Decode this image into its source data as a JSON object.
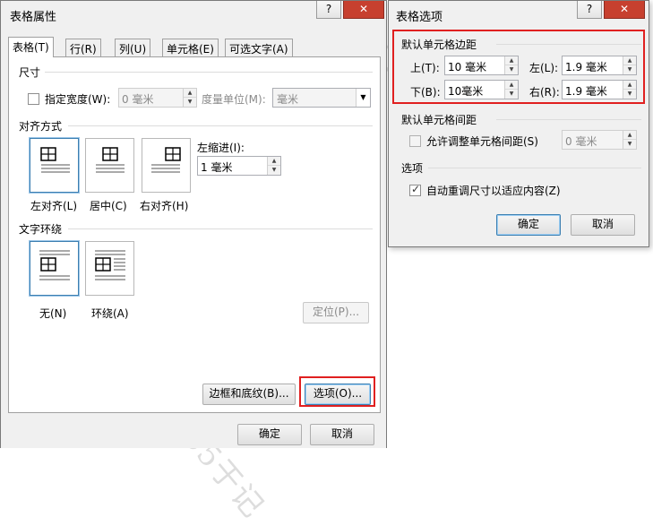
{
  "table_props": {
    "title": "表格属性",
    "help": "?",
    "close": "✕",
    "tabs": [
      "表格(T)",
      "行(R)",
      "列(U)",
      "单元格(E)",
      "可选文字(A)"
    ],
    "size": {
      "section": "尺寸",
      "preferred_width_label": "指定宽度(W):",
      "preferred_width_value": "0 毫米",
      "measure_label": "度量单位(M):",
      "measure_value": "毫米"
    },
    "alignment": {
      "section": "对齐方式",
      "left": "左对齐(L)",
      "center": "居中(C)",
      "right": "右对齐(H)",
      "indent_label": "左缩进(I):",
      "indent_value": "1 毫米"
    },
    "wrapping": {
      "section": "文字环绕",
      "none": "无(N)",
      "around": "环绕(A)",
      "positioning": "定位(P)..."
    },
    "borders_button": "边框和底纹(B)...",
    "options_button": "选项(O)...",
    "ok": "确定",
    "cancel": "取消"
  },
  "table_options": {
    "title": "表格选项",
    "help": "?",
    "close": "✕",
    "margins_section": "默认单元格边距",
    "top_label": "上(T):",
    "top_value": "10 毫米",
    "left_label": "左(L):",
    "left_value": "1.9 毫米",
    "bottom_label": "下(B):",
    "bottom_value": "10毫米",
    "right_label": "右(R):",
    "right_value": "1.9 毫米",
    "spacing_section": "默认单元格间距",
    "allow_spacing_label": "允许调整单元格间距(S)",
    "spacing_value": "0 毫米",
    "options_section": "选项",
    "autoresize_label": "自动重调尺寸以适应内容(Z)",
    "autoresize_checked": true,
    "ok": "确定",
    "cancel": "取消"
  },
  "watermark": "OFFICE365于记",
  "colors": {
    "highlight_red": "#e02020",
    "selected_blue": "#3c7fb1",
    "close_red": "#c7402f"
  }
}
